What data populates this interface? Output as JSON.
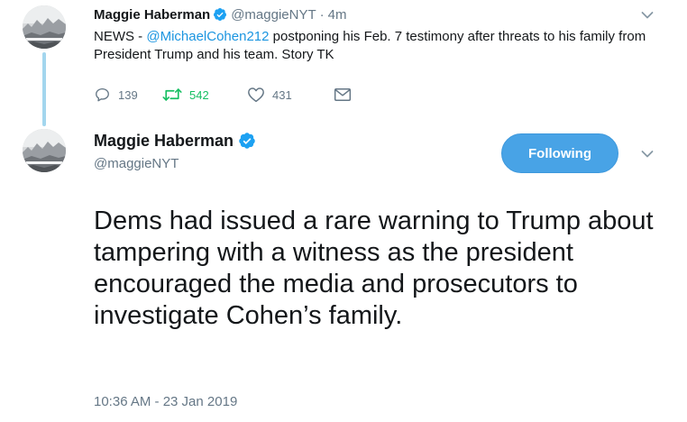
{
  "colors": {
    "accent": "#1b95e0",
    "retweet_green": "#17bf63",
    "muted": "#657786",
    "follow_button": "#48a3e6",
    "thread_line": "#a3d6ee"
  },
  "tweet_reply": {
    "author_name": "Maggie Haberman",
    "author_handle": "@maggieNYT",
    "separator": "·",
    "time": "4m",
    "text_prefix": "NEWS - ",
    "mention": "@MichaelCohen212",
    "text_suffix": " postponing his Feb. 7 testimony after threats to his family from President Trump and his team. Story TK",
    "actions": {
      "replies": "139",
      "retweets": "542",
      "likes": "431"
    },
    "icons": [
      "verified-badge-icon",
      "chevron-down-icon",
      "reply-icon",
      "retweet-icon",
      "like-heart-icon",
      "direct-message-icon"
    ]
  },
  "tweet_main": {
    "author_name": "Maggie Haberman",
    "author_handle": "@maggieNYT",
    "follow_button_label": "Following",
    "text": "Dems had issued a rare warning to Trump about tampering with a witness as the president encouraged the media and prosecutors to investigate Cohen’s family.",
    "timestamp": "10:36 AM - 23 Jan 2019",
    "icons": [
      "verified-badge-icon",
      "chevron-down-icon"
    ]
  }
}
